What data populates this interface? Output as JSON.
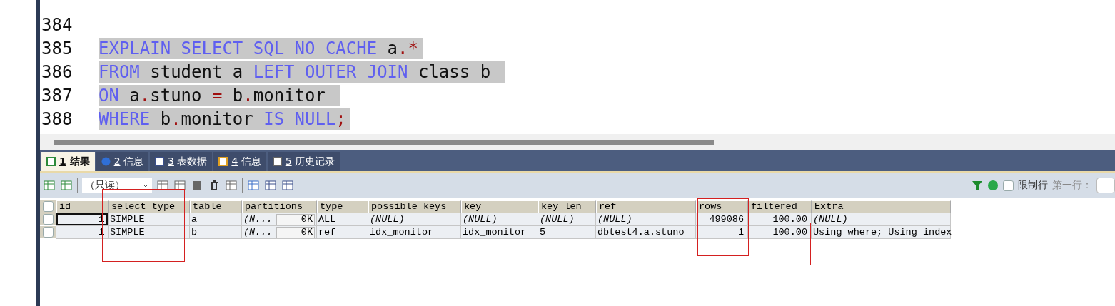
{
  "editor": {
    "lines": [
      {
        "number": "384"
      },
      {
        "number": "385",
        "selected": true,
        "tokens": [
          {
            "kind": "keyword",
            "text": "EXPLAIN SELECT SQL_NO_CACHE"
          },
          {
            "kind": "ident",
            "text": " a"
          },
          {
            "kind": "punct",
            "text": ".*"
          }
        ]
      },
      {
        "number": "386",
        "selected": true,
        "tokens": [
          {
            "kind": "keyword",
            "text": "FROM"
          },
          {
            "kind": "ident",
            "text": " student a "
          },
          {
            "kind": "keyword",
            "text": "LEFT OUTER JOIN"
          },
          {
            "kind": "ident",
            "text": " class b "
          }
        ]
      },
      {
        "number": "387",
        "selected": true,
        "tokens": [
          {
            "kind": "keyword",
            "text": "ON"
          },
          {
            "kind": "ident",
            "text": " a"
          },
          {
            "kind": "punct",
            "text": "."
          },
          {
            "kind": "ident",
            "text": "stuno "
          },
          {
            "kind": "punct",
            "text": "="
          },
          {
            "kind": "ident",
            "text": " b"
          },
          {
            "kind": "punct",
            "text": "."
          },
          {
            "kind": "ident",
            "text": "monitor "
          }
        ]
      },
      {
        "number": "388",
        "selected": true,
        "tokens": [
          {
            "kind": "keyword",
            "text": "WHERE"
          },
          {
            "kind": "ident",
            "text": " b"
          },
          {
            "kind": "punct",
            "text": "."
          },
          {
            "kind": "ident",
            "text": "monitor "
          },
          {
            "kind": "keyword",
            "text": "IS NULL"
          },
          {
            "kind": "punct",
            "text": ";"
          }
        ]
      }
    ]
  },
  "tabs": [
    {
      "key": "1",
      "label": "结果",
      "selected": true
    },
    {
      "key": "2",
      "label": "信息",
      "selected": false
    },
    {
      "key": "3",
      "label": "表数据",
      "selected": false
    },
    {
      "key": "4",
      "label": "信息",
      "selected": false
    },
    {
      "key": "5",
      "label": "历史记录",
      "selected": false
    }
  ],
  "toolbar": {
    "mode": "（只读）",
    "limit_rows": {
      "label": "限制行",
      "checked": false
    },
    "first_row_label": "第一行："
  },
  "grid": {
    "select_all_checked": false,
    "columns": [
      "id",
      "select_type",
      "table",
      "partitions",
      "type",
      "possible_keys",
      "key",
      "key_len",
      "ref",
      "rows",
      "filtered",
      "Extra"
    ],
    "rows": [
      {
        "checked": false,
        "focused": true,
        "cells": [
          {
            "kind": "number",
            "text": "1"
          },
          {
            "kind": "text",
            "text": "SIMPLE"
          },
          {
            "kind": "text",
            "text": "a"
          },
          {
            "kind": "blob",
            "text": "(N...",
            "size": "0K"
          },
          {
            "kind": "text",
            "text": "ALL"
          },
          {
            "kind": "null",
            "text": "(NULL)"
          },
          {
            "kind": "null",
            "text": "(NULL)"
          },
          {
            "kind": "null",
            "text": "(NULL)"
          },
          {
            "kind": "null",
            "text": "(NULL)"
          },
          {
            "kind": "number",
            "text": "499086"
          },
          {
            "kind": "number",
            "text": "100.00"
          },
          {
            "kind": "null",
            "text": "(NULL)"
          }
        ]
      },
      {
        "checked": false,
        "focused": false,
        "cells": [
          {
            "kind": "number",
            "text": "1"
          },
          {
            "kind": "text",
            "text": "SIMPLE"
          },
          {
            "kind": "text",
            "text": "b"
          },
          {
            "kind": "blob",
            "text": "(N...",
            "size": "0K"
          },
          {
            "kind": "text",
            "text": "ref"
          },
          {
            "kind": "text",
            "text": "idx_monitor"
          },
          {
            "kind": "text",
            "text": "idx_monitor"
          },
          {
            "kind": "text",
            "text": "5"
          },
          {
            "kind": "text",
            "text": "dbtest4.a.stuno"
          },
          {
            "kind": "number",
            "text": "1"
          },
          {
            "kind": "number",
            "text": "100.00"
          },
          {
            "kind": "text",
            "text": "Using where; Using index"
          }
        ]
      }
    ]
  }
}
